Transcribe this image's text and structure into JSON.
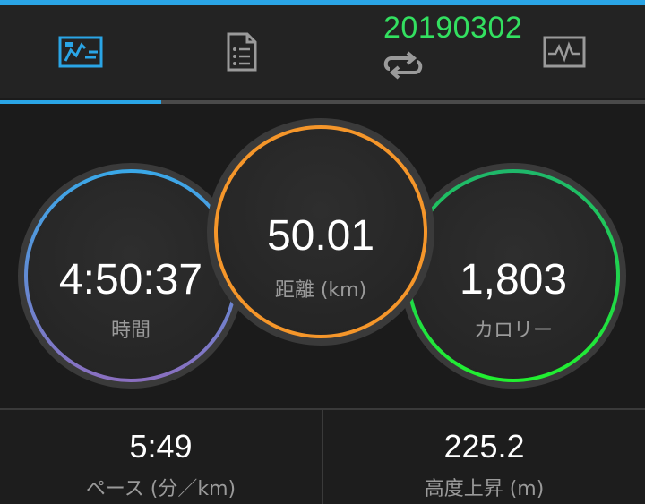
{
  "overlay": {
    "date_text": "20190302"
  },
  "tabs": [
    {
      "icon": "activity-map-icon",
      "active": true
    },
    {
      "icon": "document-list-icon",
      "active": false
    },
    {
      "icon": "laps-loop-icon",
      "active": false
    },
    {
      "icon": "chart-pulse-icon",
      "active": false
    }
  ],
  "stats": {
    "time": {
      "value": "4:50:37",
      "label": "時間"
    },
    "distance": {
      "value": "50.01",
      "label": "距離 (km)"
    },
    "calories": {
      "value": "1,803",
      "label": "カロリー"
    }
  },
  "bottom": {
    "pace": {
      "value": "5:49",
      "label": "ペース (分／km)"
    },
    "elevation": {
      "value": "225.2",
      "label": "高度上昇 (m)"
    }
  },
  "colors": {
    "accent_blue": "#2aa5e6",
    "distance_orange": "#f5962a",
    "calories_green": "#21e045",
    "date_green": "#33e060",
    "time_gradient_start": "#3aa8e8",
    "time_gradient_end": "#8a6fc0"
  }
}
